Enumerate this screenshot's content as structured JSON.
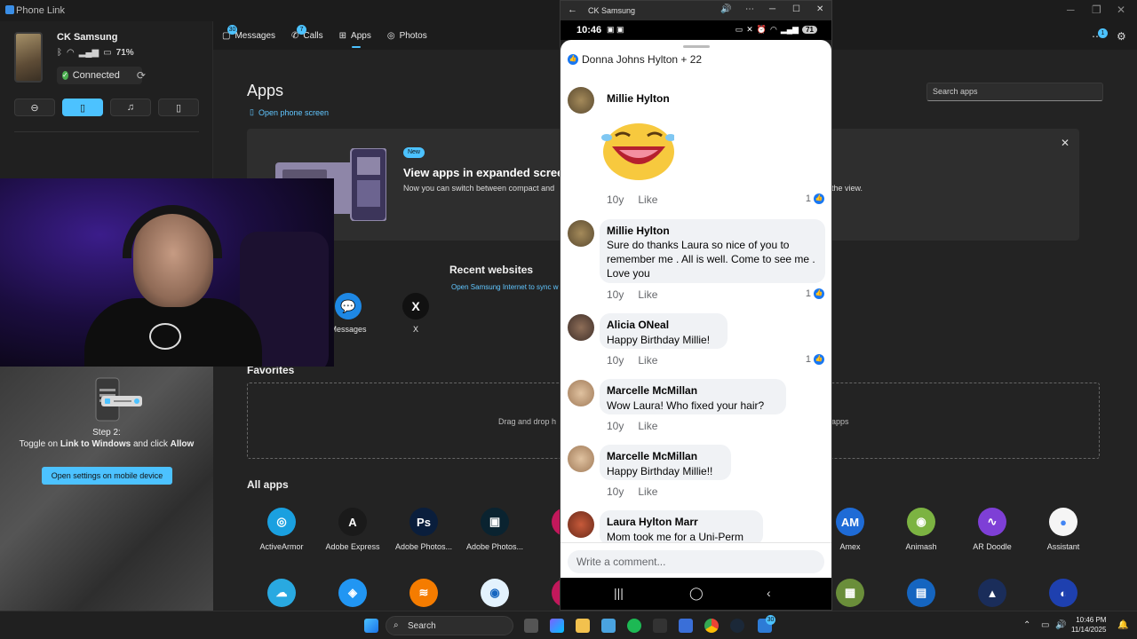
{
  "window": {
    "title": "Phone Link"
  },
  "device": {
    "name": "CK Samsung",
    "battery": "71%",
    "status": "Connected"
  },
  "quick_actions": [
    "do-not-disturb",
    "vibrate",
    "music",
    "screen-mirror"
  ],
  "nav": {
    "tabs": [
      {
        "label": "Messages",
        "badge": "30"
      },
      {
        "label": "Calls",
        "badge": "7"
      },
      {
        "label": "Apps",
        "badge": ""
      },
      {
        "label": "Photos",
        "badge": ""
      }
    ],
    "notification_badge": "1"
  },
  "setup": {
    "step_title": "Step 2:",
    "step_text_1": "Toggle on ",
    "step_bold_1": "Link to Windows",
    "step_text_2": " and click ",
    "step_bold_2": "Allow",
    "button": "Open settings on mobile device"
  },
  "main": {
    "title": "Apps",
    "open_phone_screen": "Open phone screen",
    "search_placeholder": "Search apps",
    "banner": {
      "badge": "New",
      "title": "View apps in expanded screen",
      "text": "Now you can switch between compact and",
      "text_end": "the view."
    },
    "recent": {
      "title": "Recent websites",
      "link": "Open Samsung Internet to sync w",
      "apps": [
        {
          "label": "Messages",
          "color": "#1e88e5"
        },
        {
          "label": "X",
          "color": "#111111"
        }
      ]
    },
    "favorites": {
      "title": "Favorites",
      "hint_left": "Drag and drop h",
      "hint_right": "apps"
    },
    "all_apps": {
      "title": "All apps",
      "row1": [
        {
          "label": "ActiveArmor",
          "color": "#1aa0e0",
          "glyph": "◎"
        },
        {
          "label": "Adobe Express",
          "color": "#1a1a1a",
          "glyph": "A"
        },
        {
          "label": "Adobe Photos...",
          "color": "#0a1e3c",
          "glyph": "Ps"
        },
        {
          "label": "Adobe Photos...",
          "color": "#0a2330",
          "glyph": "▣"
        },
        {
          "label": "Al",
          "color": "#c2185b",
          "glyph": ""
        },
        {
          "label": "Amex",
          "color": "#1e6bd6",
          "glyph": "AM"
        },
        {
          "label": "Animash",
          "color": "#7cb342",
          "glyph": "◉"
        },
        {
          "label": "AR Doodle",
          "color": "#7e3fd6",
          "glyph": "∿"
        },
        {
          "label": "Assistant",
          "color": "#f5f5f5",
          "glyph": "●"
        }
      ],
      "row2": [
        {
          "color": "#29a9e1",
          "glyph": "☁"
        },
        {
          "color": "#2196f3",
          "glyph": "◈"
        },
        {
          "color": "#f57c00",
          "glyph": "≋"
        },
        {
          "color": "#e3f2fd",
          "glyph": "◉"
        },
        {
          "color": "#c2185b",
          "glyph": ""
        },
        {
          "color": "#6a8e3a",
          "glyph": "▦"
        },
        {
          "color": "#1565c0",
          "glyph": "▤"
        },
        {
          "color": "#1a2d5a",
          "glyph": "▲"
        },
        {
          "color": "#1e40af",
          "glyph": "◐"
        }
      ]
    }
  },
  "phone": {
    "window_title": "CK Samsung",
    "time": "10:46 PM",
    "status_time": "10:46",
    "battery": "71",
    "header": "Donna Johns Hylton + 22",
    "comments": [
      {
        "name": "Millie Hylton",
        "text": "",
        "time": "10y",
        "like": "Like",
        "likes": "1"
      },
      {
        "name": "Millie Hylton",
        "text": "Sure do thanks Laura so nice of you to remember me . All is well. Come to see me . Love you",
        "time": "10y",
        "like": "Like",
        "likes": "1"
      },
      {
        "name": "Alicia ONeal",
        "text": "Happy Birthday Millie!",
        "time": "10y",
        "like": "Like",
        "likes": "1"
      },
      {
        "name": "Marcelle McMillan",
        "text": "Wow Laura!  Who fixed your hair?",
        "time": "10y",
        "like": "Like",
        "likes": ""
      },
      {
        "name": "Marcelle McMillan",
        "text": "Happy Birthday Millie!!",
        "time": "10y",
        "like": "Like",
        "likes": ""
      },
      {
        "name": "Laura Hylton Marr",
        "text": "Mom took me for a Uni-Perm",
        "time": "",
        "like": "",
        "likes": ""
      }
    ],
    "comment_placeholder": "Write a comment..."
  },
  "taskbar": {
    "search": "Search",
    "time": "10:46 PM",
    "date": "11/14/2025",
    "phone_badge": "30"
  }
}
